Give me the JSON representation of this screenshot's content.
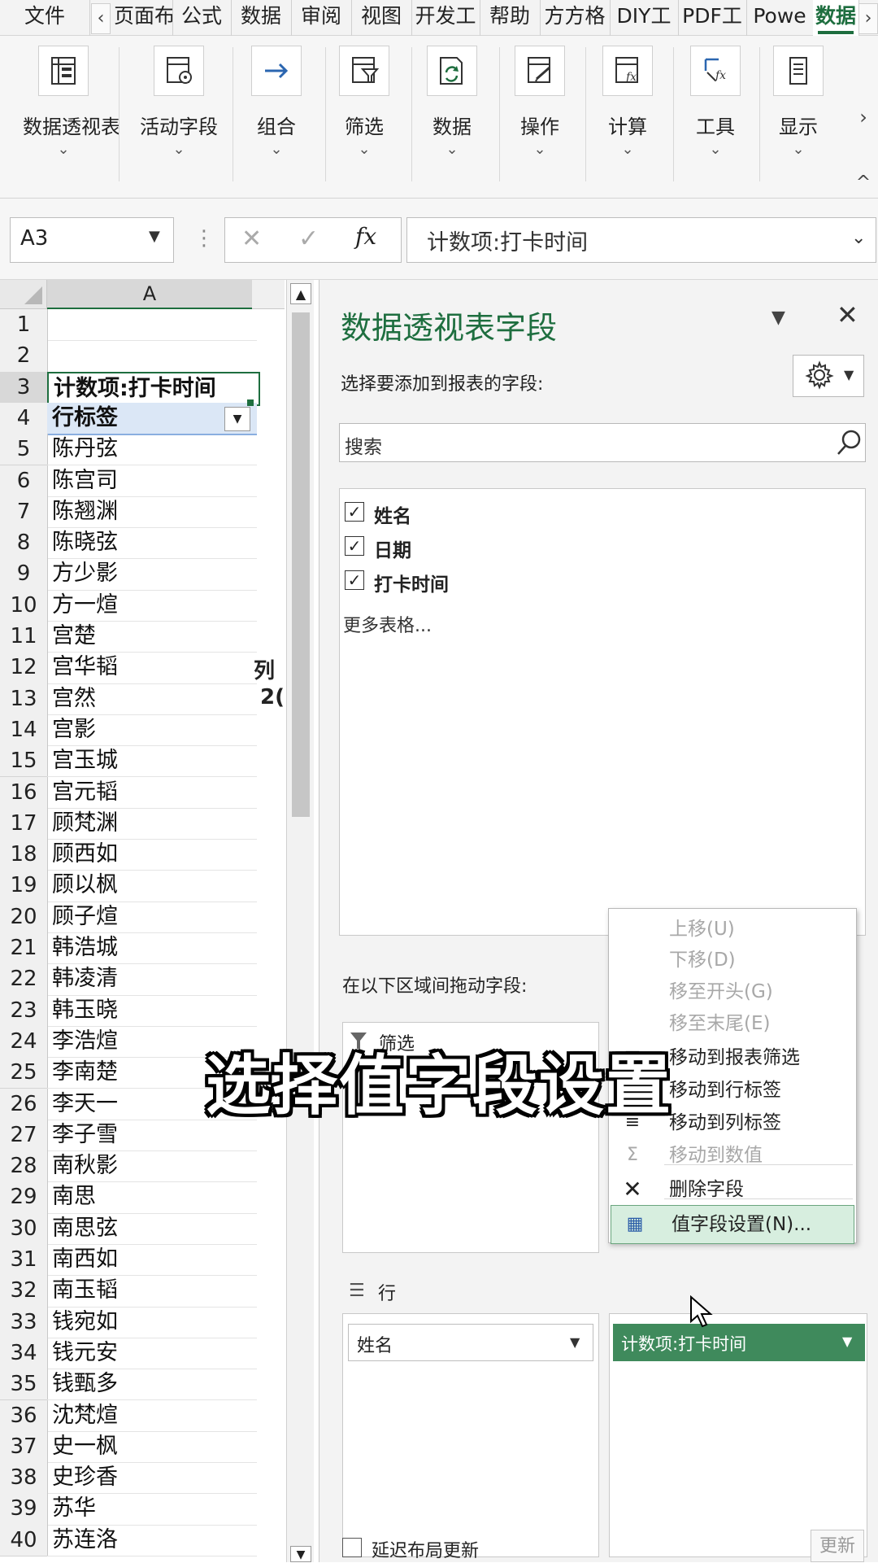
{
  "tabs": [
    "文件",
    "页面布",
    "公式",
    "数据",
    "审阅",
    "视图",
    "开发工",
    "帮助",
    "方方格",
    "DIY工",
    "PDF工",
    "Powe",
    "数据"
  ],
  "active_tab_index": 12,
  "ribbon": {
    "groups": [
      "数据透视表",
      "活动字段",
      "组合",
      "筛选",
      "数据",
      "操作",
      "计算",
      "工具",
      "显示"
    ],
    "icons": [
      "pivot-table-icon",
      "active-field-icon",
      "arrow-right-icon",
      "filter-icon",
      "refresh-data-icon",
      "actions-icon",
      "calculate-icon",
      "tools-icon",
      "show-icon"
    ]
  },
  "formula_bar": {
    "name_box": "A3",
    "fx": "fx",
    "formula": "计数项:打卡时间"
  },
  "sheet": {
    "column_header": "A",
    "col_b_row3": "列",
    "col_b_row4": "2(",
    "rows": [
      {
        "n": "1",
        "v": ""
      },
      {
        "n": "2",
        "v": ""
      },
      {
        "n": "3",
        "v": "计数项:打卡时间"
      },
      {
        "n": "4",
        "v": "行标签"
      },
      {
        "n": "5",
        "v": "陈丹弦"
      },
      {
        "n": "6",
        "v": "陈宫司"
      },
      {
        "n": "7",
        "v": "陈翘渊"
      },
      {
        "n": "8",
        "v": "陈晓弦"
      },
      {
        "n": "9",
        "v": "方少影"
      },
      {
        "n": "10",
        "v": "方一煊"
      },
      {
        "n": "11",
        "v": "宫楚"
      },
      {
        "n": "12",
        "v": "宫华韬"
      },
      {
        "n": "13",
        "v": "宫然"
      },
      {
        "n": "14",
        "v": "宫影"
      },
      {
        "n": "15",
        "v": "宫玉城"
      },
      {
        "n": "16",
        "v": "宫元韬"
      },
      {
        "n": "17",
        "v": "顾梵渊"
      },
      {
        "n": "18",
        "v": "顾西如"
      },
      {
        "n": "19",
        "v": "顾以枫"
      },
      {
        "n": "20",
        "v": "顾子煊"
      },
      {
        "n": "21",
        "v": "韩浩城"
      },
      {
        "n": "22",
        "v": "韩凌清"
      },
      {
        "n": "23",
        "v": "韩玉晓"
      },
      {
        "n": "24",
        "v": "李浩煊"
      },
      {
        "n": "25",
        "v": "李南楚"
      },
      {
        "n": "26",
        "v": "李天一"
      },
      {
        "n": "27",
        "v": "李子雪"
      },
      {
        "n": "28",
        "v": "南秋影"
      },
      {
        "n": "29",
        "v": "南思"
      },
      {
        "n": "30",
        "v": "南思弦"
      },
      {
        "n": "31",
        "v": "南西如"
      },
      {
        "n": "32",
        "v": "南玉韬"
      },
      {
        "n": "33",
        "v": "钱宛如"
      },
      {
        "n": "34",
        "v": "钱元安"
      },
      {
        "n": "35",
        "v": "钱甄多"
      },
      {
        "n": "36",
        "v": "沈梵煊"
      },
      {
        "n": "37",
        "v": "史一枫"
      },
      {
        "n": "38",
        "v": "史珍香"
      },
      {
        "n": "39",
        "v": "苏华"
      },
      {
        "n": "40",
        "v": "苏连洛"
      }
    ]
  },
  "pane": {
    "title": "数据透视表字段",
    "subtitle": "选择要添加到报表的字段:",
    "search_placeholder": "搜索",
    "fields": [
      "姓名",
      "日期",
      "打卡时间"
    ],
    "more_tables": "更多表格...",
    "drag_label": "在以下区域间拖动字段:",
    "filter_label": "筛选",
    "rows_label": "行",
    "rows_item": "姓名",
    "values_item": "计数项:打卡时间",
    "defer_label": "延迟布局更新",
    "update_button": "更新"
  },
  "context_menu": {
    "items": [
      {
        "label": "上移(U)",
        "disabled": true,
        "icon": ""
      },
      {
        "label": "下移(D)",
        "disabled": true,
        "icon": ""
      },
      {
        "label": "移至开头(G)",
        "disabled": true,
        "icon": ""
      },
      {
        "label": "移至末尾(E)",
        "disabled": true,
        "icon": ""
      },
      {
        "label": "移动到报表筛选",
        "disabled": false,
        "icon": "filter-icon"
      },
      {
        "label": "移动到行标签",
        "disabled": false,
        "icon": "rows-icon"
      },
      {
        "label": "移动到列标签",
        "disabled": false,
        "icon": "columns-icon"
      },
      {
        "label": "移动到数值",
        "disabled": true,
        "icon": "sigma-icon"
      },
      {
        "label": "删除字段",
        "disabled": false,
        "icon": "close-icon"
      },
      {
        "label": "值字段设置(N)...",
        "disabled": false,
        "icon": "field-settings-icon",
        "highlighted": true
      }
    ]
  },
  "caption": "选择值字段设置",
  "colors": {
    "accent_green": "#1e6e3f",
    "values_green": "#3f8a5c",
    "highlight_bg": "#d7eedf",
    "selected_row_bg": "#dbe7f6"
  }
}
